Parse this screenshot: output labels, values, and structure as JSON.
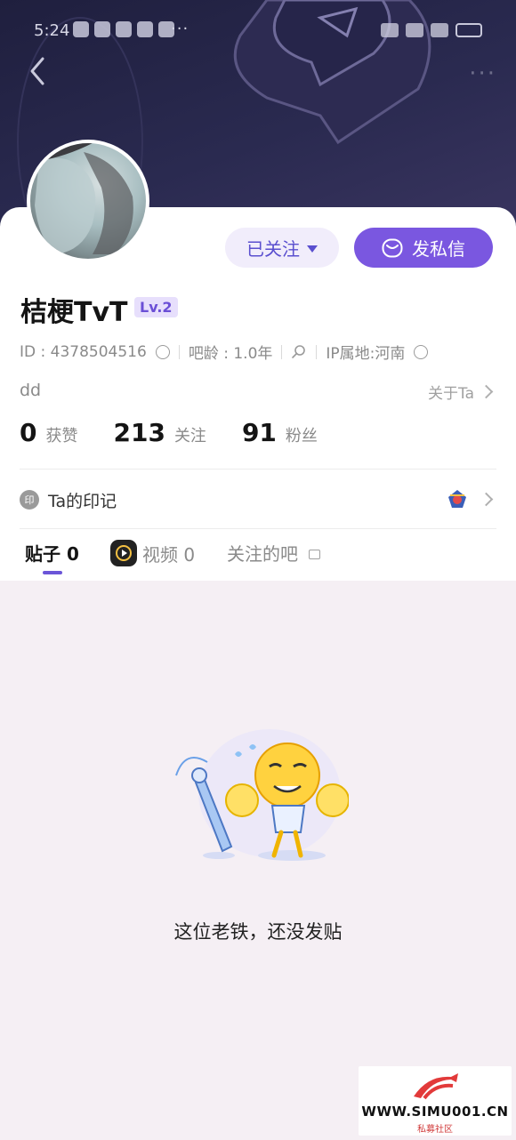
{
  "status_bar": {
    "time": "5:24",
    "more": "···"
  },
  "profile": {
    "username": "桔梗TvT",
    "level": "Lv.2",
    "id_text": "ID : 4378504516",
    "bar_age": "吧龄 : 1.0年",
    "ip_location": "IP属地:河南",
    "bio": "dd",
    "about_link": "关于Ta",
    "avatar": "avatar"
  },
  "actions": {
    "followed_label": "已关注",
    "message_label": "发私信"
  },
  "stats": [
    {
      "value": "0",
      "label": "获赞"
    },
    {
      "value": "213",
      "label": "关注"
    },
    {
      "value": "91",
      "label": "粉丝"
    }
  ],
  "marks": {
    "icon_text": "印",
    "label": "Ta的印记"
  },
  "tabs": [
    {
      "label": "贴子 0"
    },
    {
      "label": "视频 0"
    },
    {
      "label": "关注的吧"
    }
  ],
  "empty_state": {
    "message": "这位老铁，还没发贴"
  },
  "watermark": {
    "url": "WWW.SIMU001.CN",
    "subtitle": "私募社区"
  },
  "colors": {
    "accent": "#7a57e0",
    "header_bg": "#22223f",
    "page_bg": "#f5eff4"
  }
}
